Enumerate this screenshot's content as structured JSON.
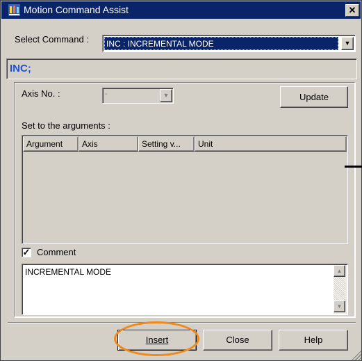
{
  "window": {
    "title": "Motion Command Assist",
    "close_glyph": "✕"
  },
  "command": {
    "label": "Select Command :",
    "value": "INC : INCREMENTAL MODE"
  },
  "preview": {
    "text": "INC;"
  },
  "axis": {
    "label": "Axis No. :",
    "value": "-"
  },
  "update_label": "Update",
  "arguments": {
    "label": "Set to the arguments :",
    "columns": [
      "Argument",
      "Axis",
      "Setting v...",
      "Unit"
    ]
  },
  "comment": {
    "check_label": "Comment",
    "checked": true,
    "text": "INCREMENTAL MODE"
  },
  "buttons": {
    "insert": "Insert",
    "close": "Close",
    "help": "Help"
  },
  "colors": {
    "title_bar": "#0a246a",
    "highlight": "#ef8a1a",
    "preview_text": "#1a53d6"
  }
}
